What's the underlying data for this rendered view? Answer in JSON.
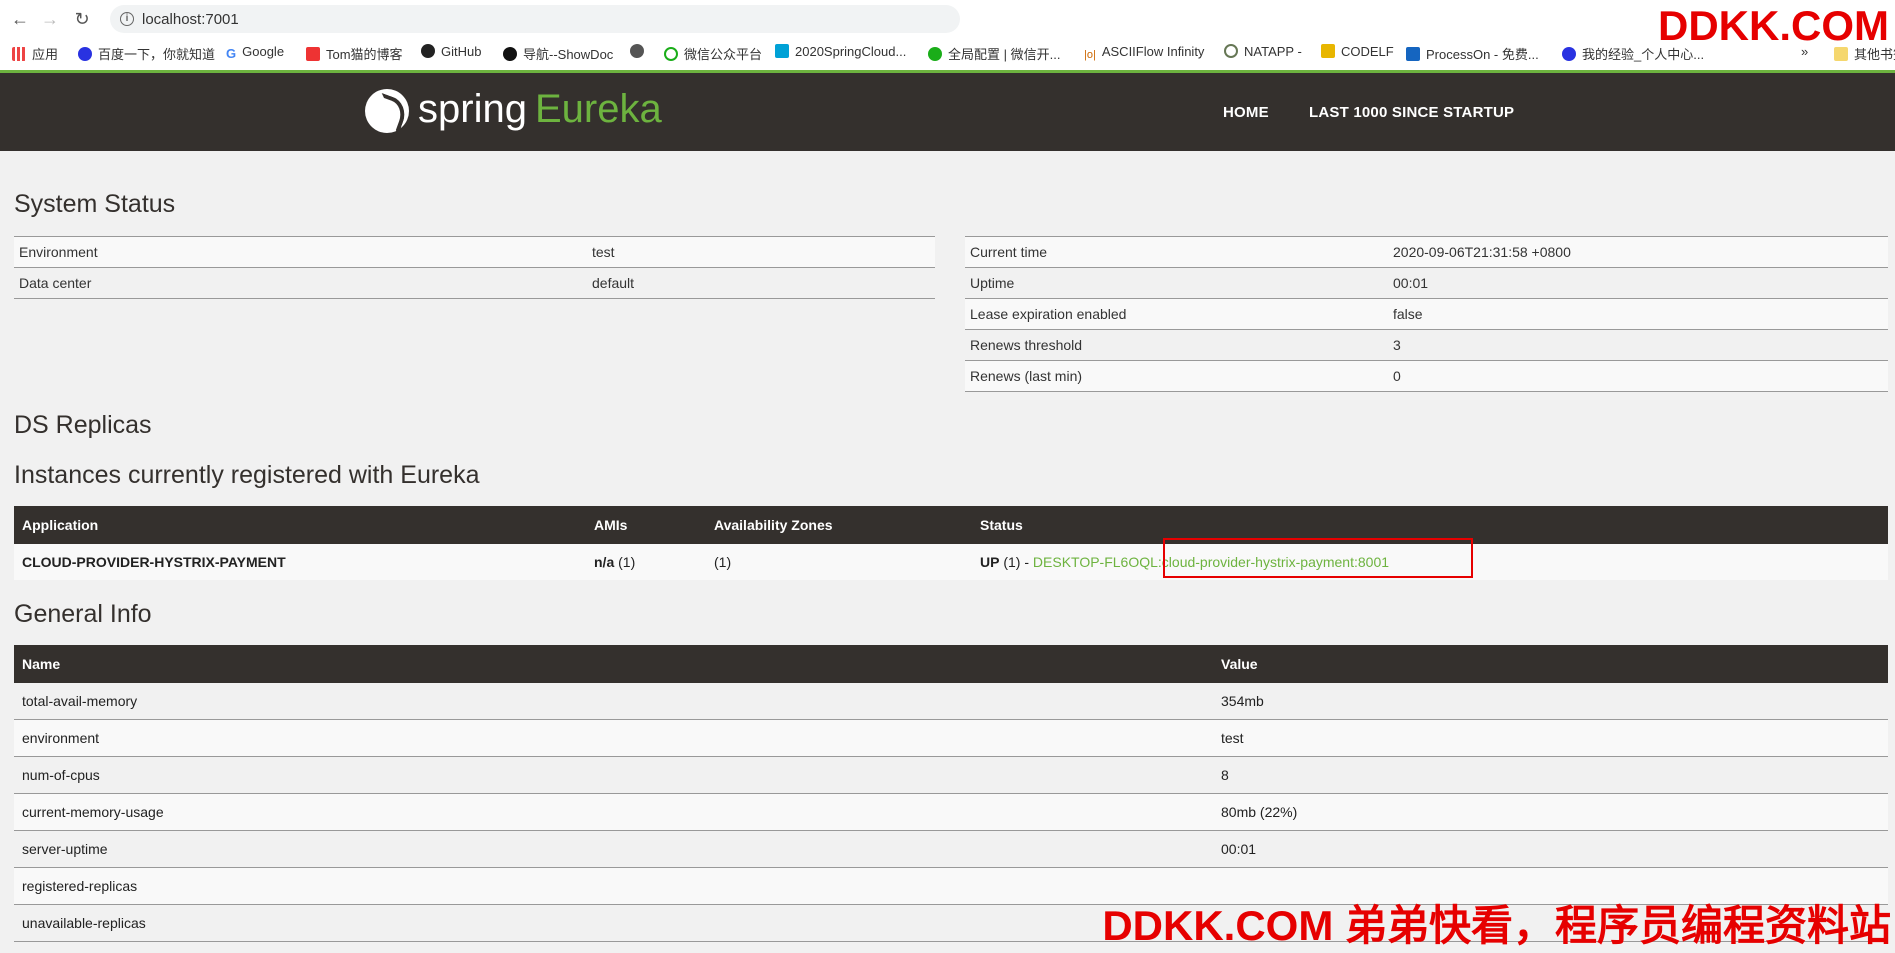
{
  "browser": {
    "url": "localhost:7001",
    "bookmarks": [
      "应用",
      "百度一下，你就知道",
      "Google",
      "Tom猫的博客",
      "GitHub",
      "导航--ShowDoc",
      "",
      "微信公众平台",
      "2020SpringCloud...",
      "全局配置 | 微信开...",
      "ASCIIFlow Infinity",
      "NATAPP -",
      "CODELF",
      "ProcessOn - 免费...",
      "我的经验_个人中心...",
      "»",
      "其他书签"
    ]
  },
  "header": {
    "logo_spring": "spring",
    "logo_eureka": "Eureka",
    "nav": [
      "HOME",
      "LAST 1000 SINCE STARTUP"
    ]
  },
  "system_status": {
    "title": "System Status",
    "left": [
      {
        "label": "Environment",
        "value": "test"
      },
      {
        "label": "Data center",
        "value": "default"
      }
    ],
    "right": [
      {
        "label": "Current time",
        "value": "2020-09-06T21:31:58 +0800"
      },
      {
        "label": "Uptime",
        "value": "00:01"
      },
      {
        "label": "Lease expiration enabled",
        "value": "false"
      },
      {
        "label": "Renews threshold",
        "value": "3"
      },
      {
        "label": "Renews (last min)",
        "value": "0"
      }
    ]
  },
  "ds_replicas": {
    "title": "DS Replicas"
  },
  "instances": {
    "title": "Instances currently registered with Eureka",
    "headers": [
      "Application",
      "AMIs",
      "Availability Zones",
      "Status"
    ],
    "rows": [
      {
        "application": "CLOUD-PROVIDER-HYSTRIX-PAYMENT",
        "amis_strong": "n/a",
        "amis_count": "(1)",
        "zones": "(1)",
        "status_prefix": "UP",
        "status_count": "(1) -",
        "instance_link": "DESKTOP-FL6OQL:cloud-provider-hystrix-payment:8001"
      }
    ]
  },
  "general_info": {
    "title": "General Info",
    "headers": [
      "Name",
      "Value"
    ],
    "rows": [
      {
        "name": "total-avail-memory",
        "value": "354mb"
      },
      {
        "name": "environment",
        "value": "test"
      },
      {
        "name": "num-of-cpus",
        "value": "8"
      },
      {
        "name": "current-memory-usage",
        "value": "80mb (22%)"
      },
      {
        "name": "server-uptime",
        "value": "00:01"
      },
      {
        "name": "registered-replicas",
        "value": ""
      },
      {
        "name": "unavailable-replicas",
        "value": ""
      }
    ]
  },
  "watermark": {
    "top": "DDKK.COM",
    "bottom": "DDKK.COM 弟弟快看，程序员编程资料站"
  },
  "colors": {
    "accent": "#6db33f",
    "navbar": "#34302d",
    "highlight": "#e60000"
  }
}
